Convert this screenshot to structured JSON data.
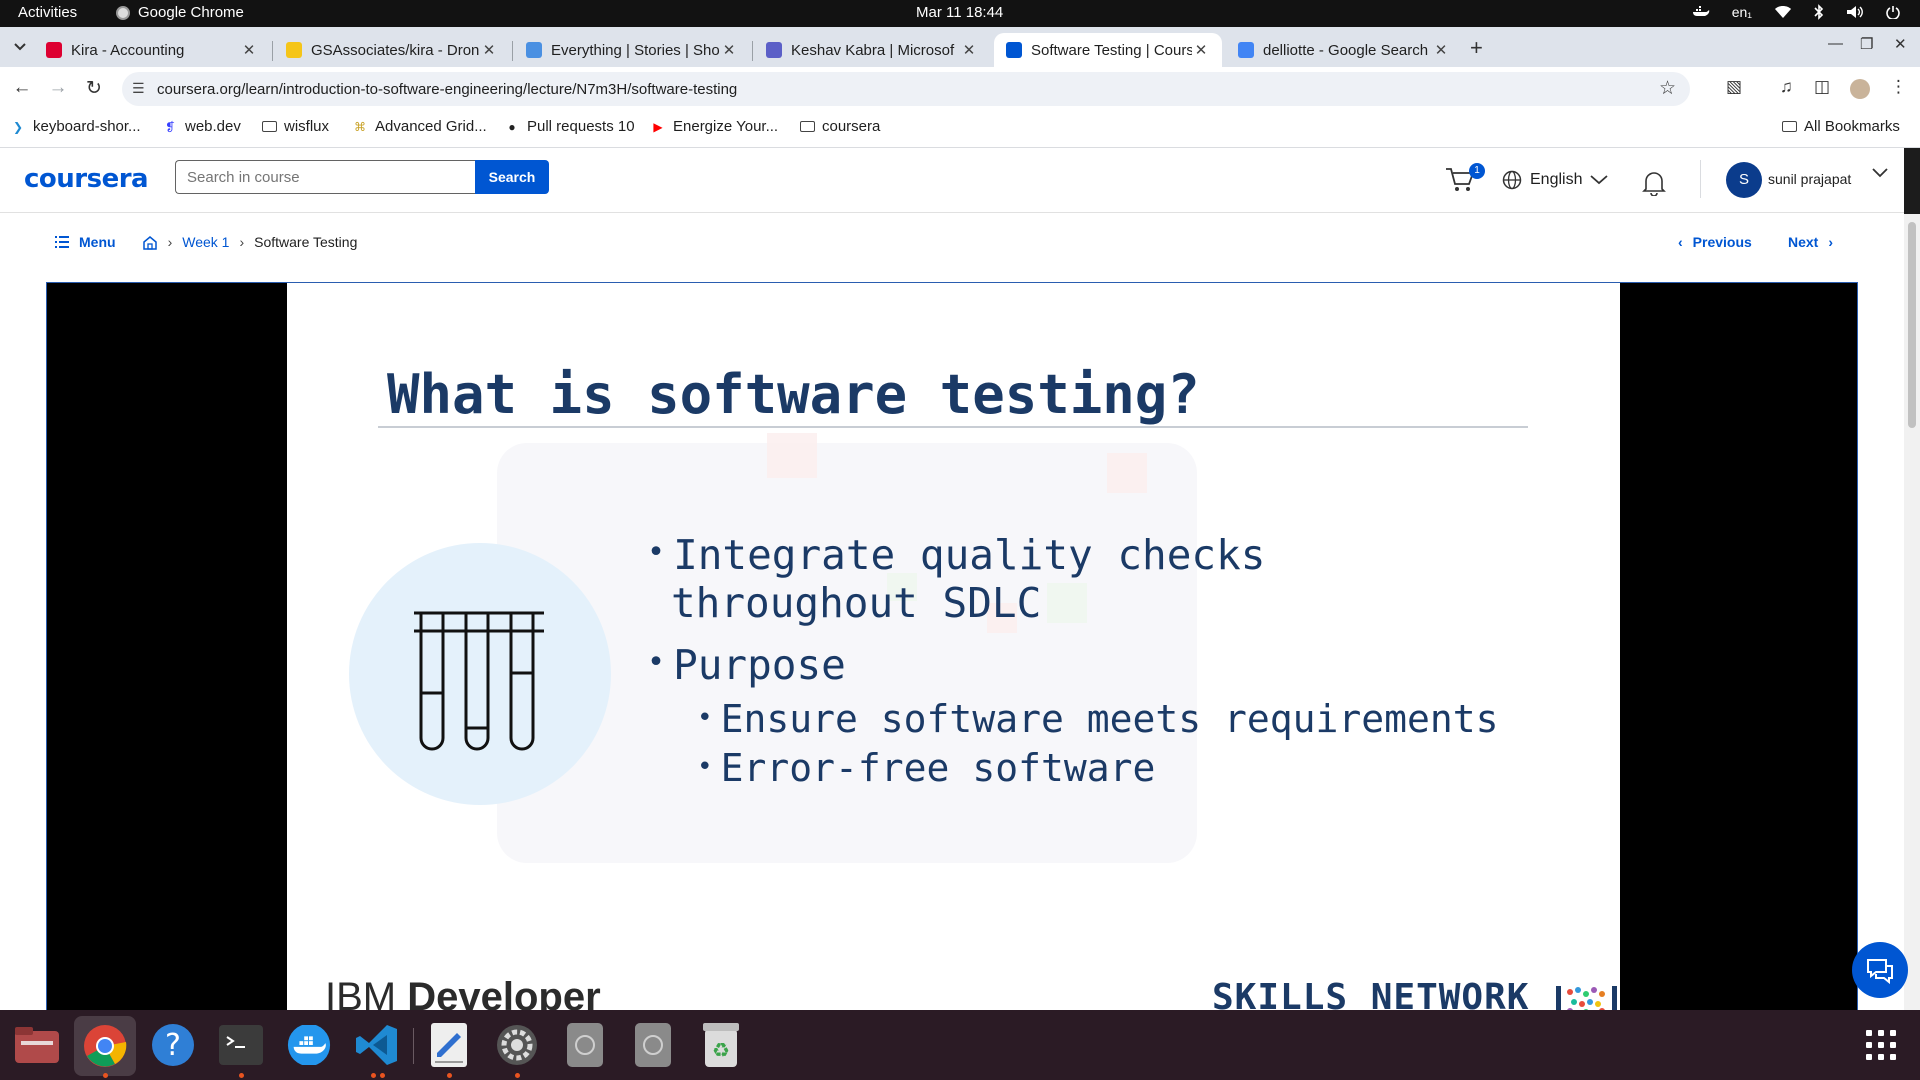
{
  "topbar": {
    "activities": "Activities",
    "app_name": "Google Chrome",
    "clock": "Mar 11  18:44",
    "keyboard_layout": "en₁"
  },
  "tabs": [
    {
      "title": "Kira - Accounting",
      "icon": "angular-icon",
      "color": "#dd0031",
      "active": false
    },
    {
      "title": "GSAssociates/kira - Dron",
      "icon": "drone-ci-icon",
      "color": "#f5c518",
      "active": false
    },
    {
      "title": "Everything | Stories | Sho",
      "icon": "storybook-icon",
      "color": "#4a90e2",
      "active": false
    },
    {
      "title": "Keshav Kabra | Microsof",
      "icon": "teams-icon",
      "color": "#5b5fc7",
      "active": false
    },
    {
      "title": "Software Testing | Cours",
      "icon": "coursera-icon",
      "color": "#0056d2",
      "active": true
    },
    {
      "title": "delliotte - Google Search",
      "icon": "google-icon",
      "color": "#4285f4",
      "active": false
    }
  ],
  "toolbar": {
    "url": "coursera.org/learn/introduction-to-software-engineering/lecture/N7m3H/software-testing"
  },
  "bookmarks": [
    {
      "label": "keyboard-shor...",
      "icon": "vscode-icon"
    },
    {
      "label": "web.dev",
      "icon": "webdev-icon"
    },
    {
      "label": "wisflux",
      "icon": "folder-icon"
    },
    {
      "label": "Advanced Grid...",
      "icon": "bookmark-icon"
    },
    {
      "label": "Pull requests 10",
      "icon": "github-icon"
    },
    {
      "label": "Energize Your...",
      "icon": "youtube-icon"
    },
    {
      "label": "coursera",
      "icon": "folder-icon"
    }
  ],
  "all_bookmarks": "All Bookmarks",
  "header": {
    "logo": "coursera",
    "search_placeholder": "Search in course",
    "search_button": "Search",
    "cart_count": "1",
    "language": "English",
    "avatar_initial": "S",
    "user_name": "sunil prajapat"
  },
  "breadcrumb": {
    "menu": "Menu",
    "week": "Week 1",
    "current": "Software Testing"
  },
  "pager": {
    "previous": "Previous",
    "next": "Next"
  },
  "slide": {
    "title": "What is software testing?",
    "bullet1_line1": "Integrate quality checks",
    "bullet1_line2": "throughout SDLC",
    "bullet2": "Purpose",
    "sub1": "Ensure software meets requirements",
    "sub2": "Error-free software",
    "footer_left_light": "IBM ",
    "footer_left_bold": "Developer",
    "footer_right": "SKILLS NETWORK"
  },
  "colors": {
    "brand": "#0056d2",
    "slide_text": "#1b3a66",
    "dock_bg": "#2b1b25"
  },
  "dock": [
    "files-icon",
    "chrome-icon",
    "help-icon",
    "terminal-icon",
    "docker-icon",
    "vscode-icon",
    "text-editor-icon",
    "settings-icon",
    "disk-icon",
    "disk-icon-2",
    "trash-icon"
  ]
}
